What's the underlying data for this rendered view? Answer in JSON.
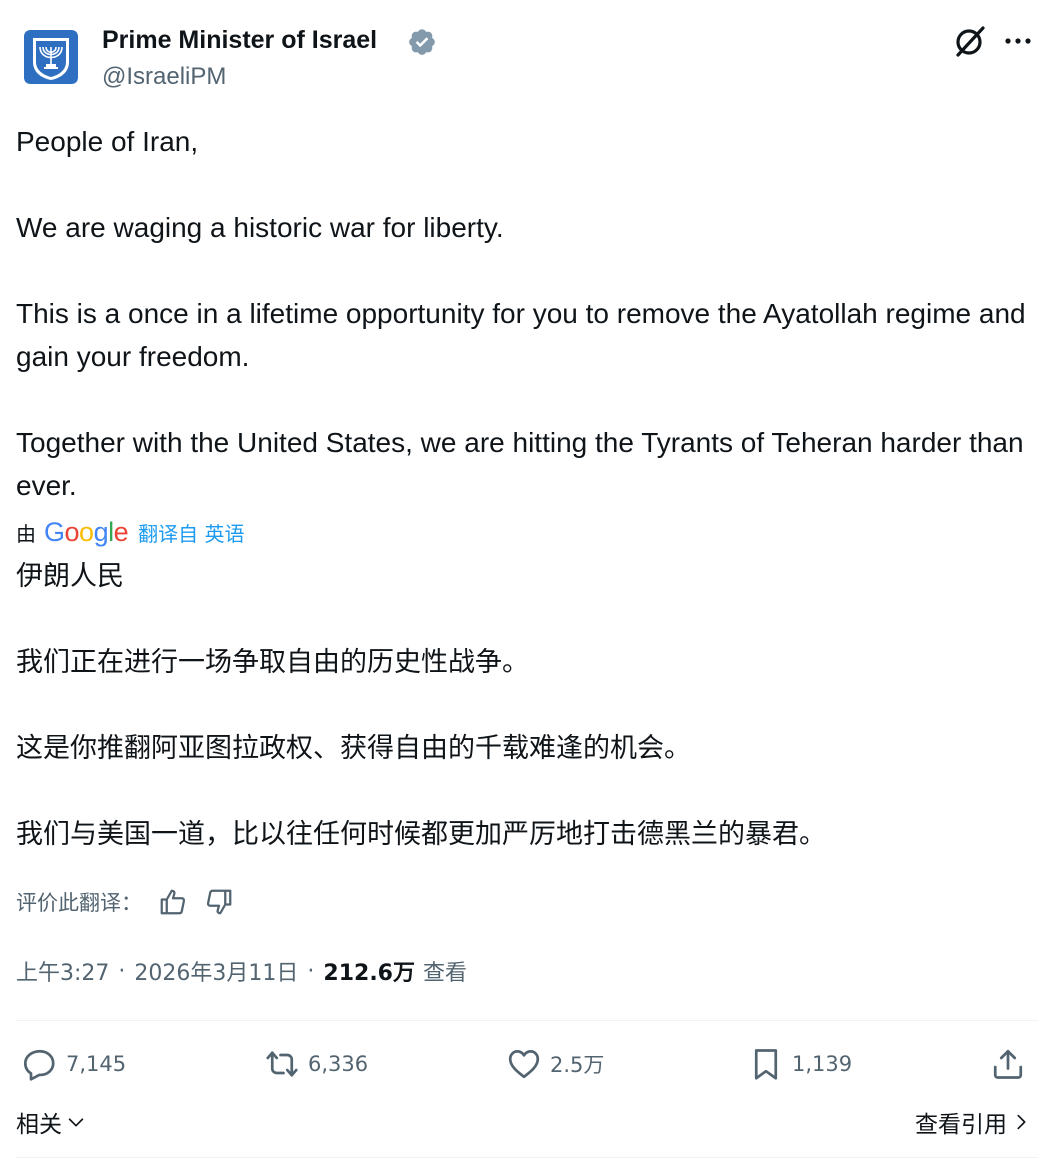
{
  "author": {
    "name": "Prime Minister of Israel",
    "handle": "@IsraeliPM",
    "verified": true,
    "verified_color": "#829aab"
  },
  "header_icons": {
    "grok": "grok-icon",
    "more": "more-icon"
  },
  "tweet": {
    "paragraphs": [
      "People of Iran,",
      "We are waging a historic war for liberty.",
      "This is a once in a lifetime opportunity for you to remove the Ayatollah regime and gain your freedom.",
      "Together with the United States, we are hitting the Tyrants of Teheran harder than ever."
    ]
  },
  "translation": {
    "by_label": "由",
    "provider": "Google",
    "link_text": "翻译自 英语",
    "paragraphs": [
      "伊朗人民",
      "我们正在进行一场争取自由的历史性战争。",
      "这是你推翻阿亚图拉政权、获得自由的千载难逢的机会。",
      "我们与美国一道，比以往任何时候都更加严厉地打击德黑兰的暴君。"
    ],
    "rate_label": "评价此翻译："
  },
  "meta": {
    "time": "上午3:27",
    "date": "2026年3月11日",
    "views": "212.6万",
    "views_label": "查看"
  },
  "actions": {
    "replies": "7,145",
    "reposts": "6,336",
    "likes": "2.5万",
    "bookmarks": "1,139"
  },
  "footer": {
    "related": "相关",
    "quotes": "查看引用"
  },
  "colors": {
    "text": "#0f1419",
    "secondary": "#536471",
    "link": "#1d9bf0",
    "divider": "#eff3f4",
    "avatar_blue": "#2f6fc2"
  }
}
